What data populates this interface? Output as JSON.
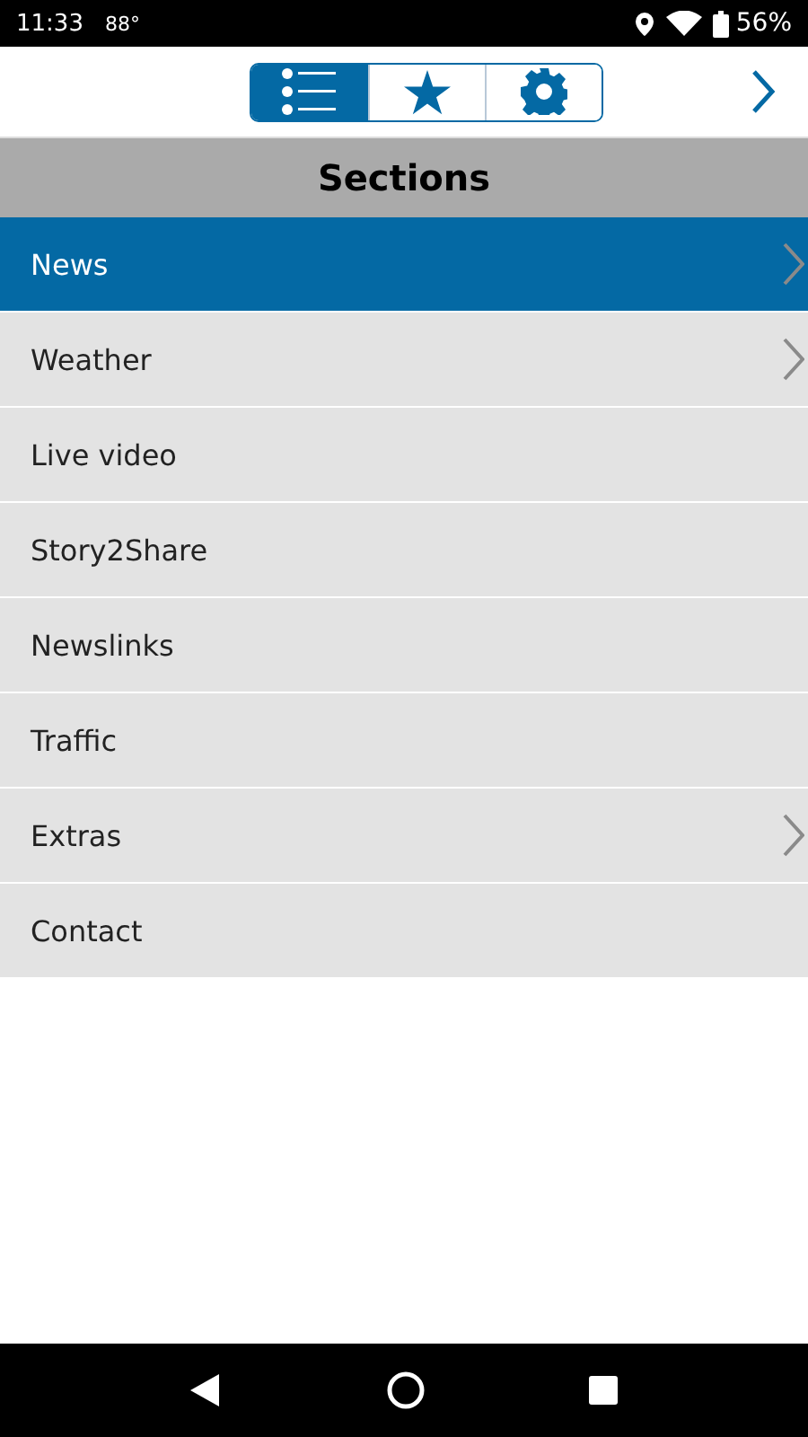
{
  "status_bar": {
    "time": "11:33",
    "temperature": "88°",
    "battery": "56%"
  },
  "toolbar": {
    "tabs": [
      {
        "kind": "list",
        "selected": true
      },
      {
        "kind": "star",
        "selected": false
      },
      {
        "kind": "gear",
        "selected": false
      }
    ]
  },
  "header": {
    "title": "Sections"
  },
  "sections": [
    {
      "label": "News",
      "selected": true,
      "has_children": true
    },
    {
      "label": "Weather",
      "selected": false,
      "has_children": true
    },
    {
      "label": "Live video",
      "selected": false,
      "has_children": false
    },
    {
      "label": "Story2Share",
      "selected": false,
      "has_children": false
    },
    {
      "label": "Newslinks",
      "selected": false,
      "has_children": false
    },
    {
      "label": "Traffic",
      "selected": false,
      "has_children": false
    },
    {
      "label": "Extras",
      "selected": false,
      "has_children": true
    },
    {
      "label": "Contact",
      "selected": false,
      "has_children": false
    }
  ]
}
